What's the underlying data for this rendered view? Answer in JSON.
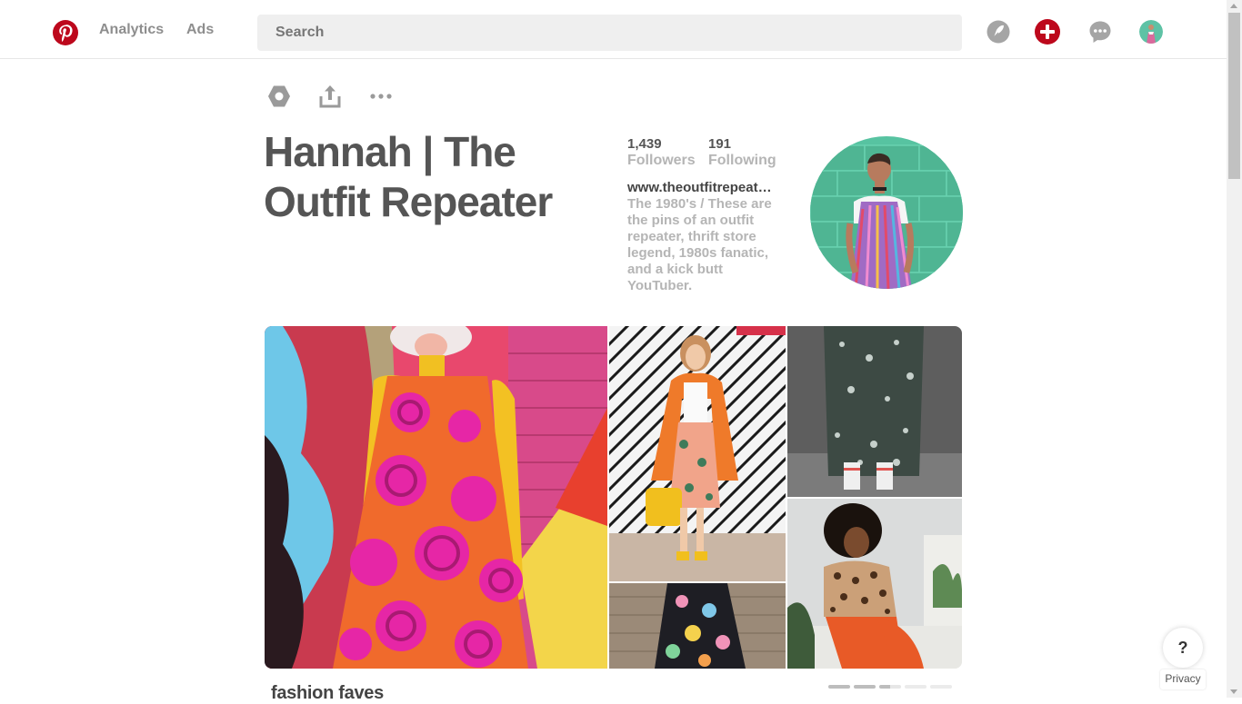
{
  "header": {
    "nav": {
      "analytics_label": "Analytics",
      "ads_label": "Ads"
    },
    "search": {
      "placeholder": "Search",
      "value": ""
    },
    "icons": [
      "pinterest-logo-icon",
      "explore-compass-icon",
      "add-icon",
      "messages-icon",
      "profile-avatar"
    ]
  },
  "profile": {
    "name": "Hannah | The Outfit Repeater",
    "followers_count": "1,439",
    "followers_label": "Followers",
    "following_count": "191",
    "following_label": "Following",
    "website": "www.theoutfitrepeat…",
    "bio": "The 1980's / These are the pins of an outfit repeater, thrift store legend, 1980s fanatic, and a kick butt YouTuber.",
    "actions": [
      "settings-icon",
      "share-icon",
      "more-options-icon"
    ]
  },
  "board": {
    "title": "fashion faves",
    "carousel_pages": 5,
    "carousel_active_pages": 3
  },
  "help": {
    "button_label": "?",
    "privacy_label": "Privacy"
  },
  "colors": {
    "brand_red": "#bd081c",
    "icon_gray": "#8e8e8e",
    "muted_text": "#b5b5b5",
    "search_bg": "#efefef"
  }
}
